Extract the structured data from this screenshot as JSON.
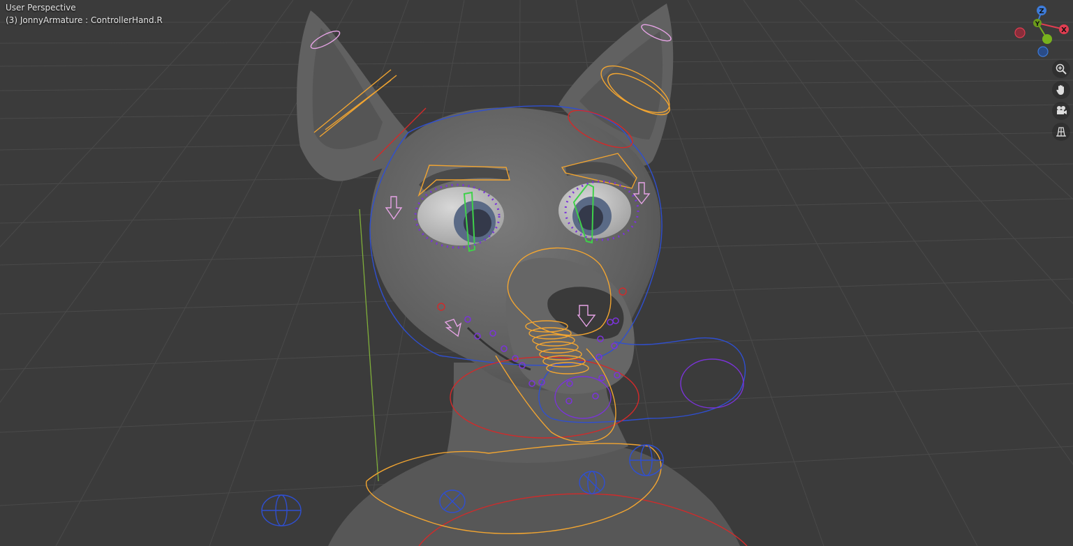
{
  "viewport": {
    "view_label": "User Perspective",
    "object_label": "(3) JonnyArmature : ControllerHand.R"
  },
  "gizmo": {
    "z_label": "Z",
    "y_label": "Y",
    "x_label": "X",
    "colors": {
      "x": "#e13d51",
      "y": "#78b21d",
      "z": "#3d7bd9"
    }
  },
  "nav_buttons": [
    {
      "name": "zoom",
      "icon": "zoom-icon"
    },
    {
      "name": "pan",
      "icon": "hand-icon"
    },
    {
      "name": "camera",
      "icon": "camera-icon"
    },
    {
      "name": "ortho",
      "icon": "grid-icon"
    }
  ],
  "colors": {
    "background": "#3b3b3b",
    "grid": "#4a4a4a",
    "mesh": "#666666",
    "bone_orange": "#f2a531",
    "bone_blue": "#2f4fd1",
    "bone_red": "#d22a2a",
    "bone_purple": "#7a34d8",
    "bone_green": "#3fd14a",
    "bone_pink": "#e7a4e6"
  }
}
